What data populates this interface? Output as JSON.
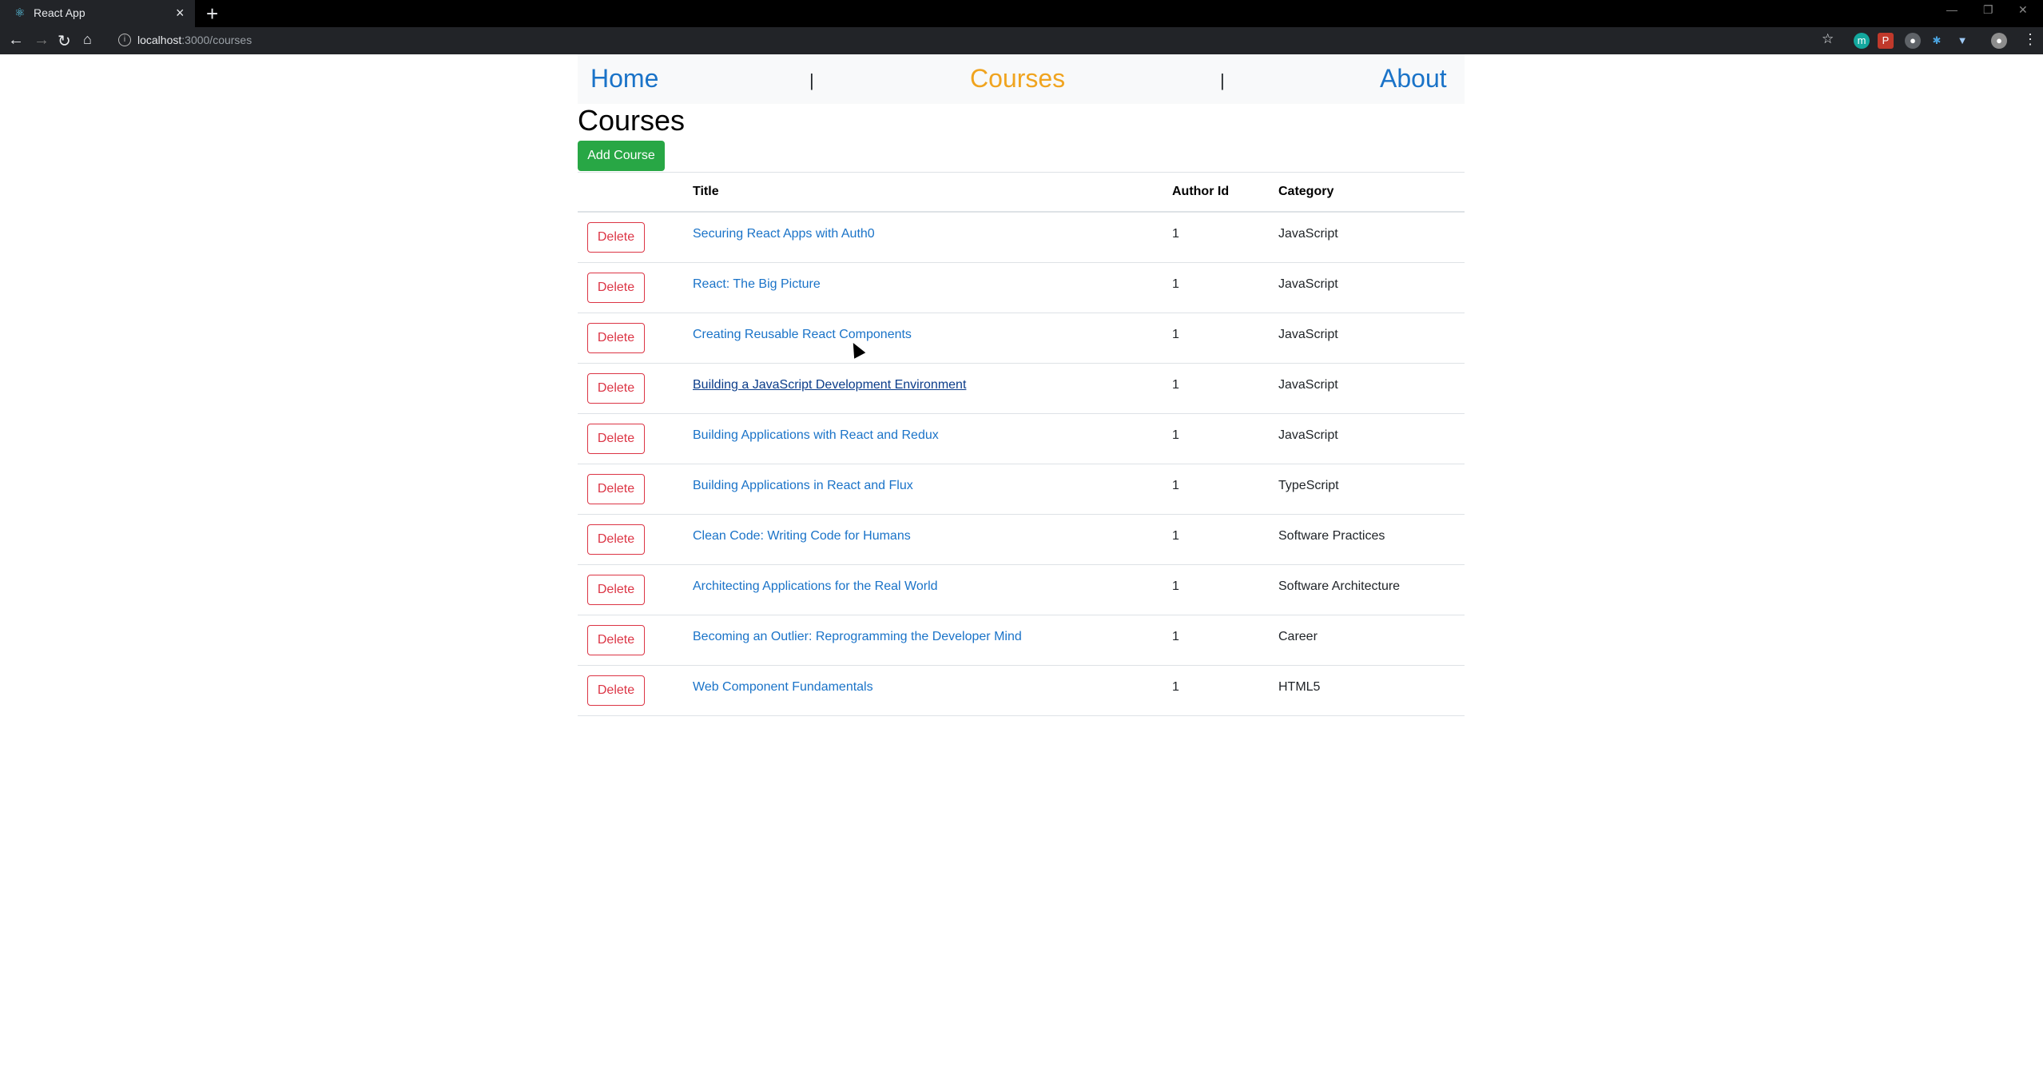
{
  "browser": {
    "tab_title": "React App",
    "url_host": "localhost",
    "url_path": ":3000/courses"
  },
  "nav": {
    "home": "Home",
    "courses": "Courses",
    "about": "About",
    "separator": "|"
  },
  "page": {
    "title": "Courses",
    "add_button": "Add Course"
  },
  "table": {
    "headers": [
      "",
      "Title",
      "Author Id",
      "Category"
    ],
    "delete_label": "Delete",
    "rows": [
      {
        "title": "Securing React Apps with Auth0",
        "author_id": "1",
        "category": "JavaScript"
      },
      {
        "title": "React: The Big Picture",
        "author_id": "1",
        "category": "JavaScript"
      },
      {
        "title": "Creating Reusable React Components",
        "author_id": "1",
        "category": "JavaScript"
      },
      {
        "title": "Building a JavaScript Development Environment",
        "author_id": "1",
        "category": "JavaScript"
      },
      {
        "title": "Building Applications with React and Redux",
        "author_id": "1",
        "category": "JavaScript"
      },
      {
        "title": "Building Applications in React and Flux",
        "author_id": "1",
        "category": "TypeScript"
      },
      {
        "title": "Clean Code: Writing Code for Humans",
        "author_id": "1",
        "category": "Software Practices"
      },
      {
        "title": "Architecting Applications for the Real World",
        "author_id": "1",
        "category": "Software Architecture"
      },
      {
        "title": "Becoming an Outlier: Reprogramming the Developer Mind",
        "author_id": "1",
        "category": "Career"
      },
      {
        "title": "Web Component Fundamentals",
        "author_id": "1",
        "category": "HTML5"
      }
    ]
  },
  "colors": {
    "active_nav": "#f0a41f",
    "link": "#1a73c8",
    "add_button": "#28a745",
    "delete_button": "#dc3545"
  }
}
